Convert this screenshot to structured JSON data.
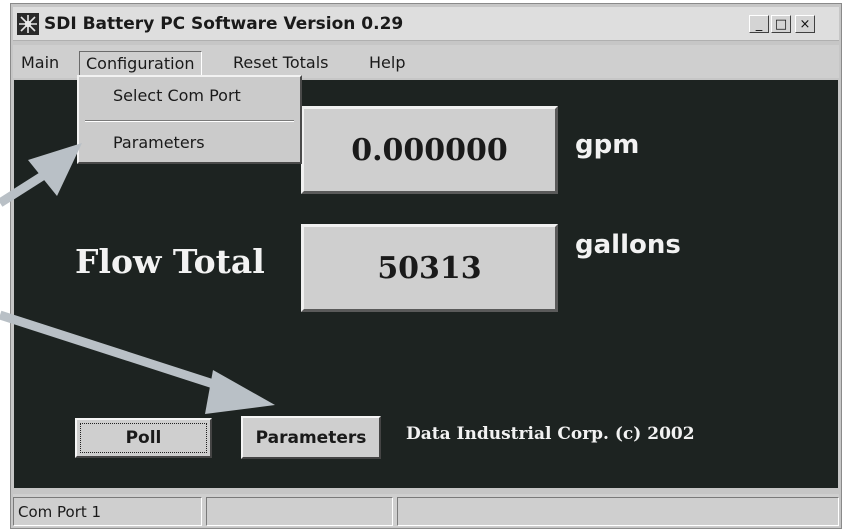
{
  "window": {
    "title": "SDI Battery PC Software Version 0.29",
    "buttons": {
      "minimize": "_",
      "maximize": "□",
      "close": "×"
    }
  },
  "menu": {
    "items": [
      {
        "label": "Main"
      },
      {
        "label": "Configuration"
      },
      {
        "label": "Reset Totals"
      },
      {
        "label": "Help"
      }
    ],
    "open_dropdown": {
      "parent": "Configuration",
      "items": [
        "Select Com Port",
        "Parameters"
      ]
    }
  },
  "readouts": {
    "flow_rate": {
      "value": "0.000000",
      "unit": "gpm"
    },
    "flow_total": {
      "label": "Flow Total",
      "value": "50313",
      "unit": "gallons"
    }
  },
  "buttons": {
    "poll": "Poll",
    "parameters": "Parameters"
  },
  "copyright": "Data Industrial Corp. (c) 2002",
  "statusbar": {
    "cells": [
      "Com Port 1",
      "",
      ""
    ]
  },
  "colors": {
    "client_background": "#1d2321",
    "panel_gray": "#cfcfcf",
    "arrow": "#b9c0c6"
  },
  "icons": [
    "app-icon",
    "minimize-icon",
    "maximize-icon",
    "close-icon",
    "pointer-arrow-icon"
  ]
}
